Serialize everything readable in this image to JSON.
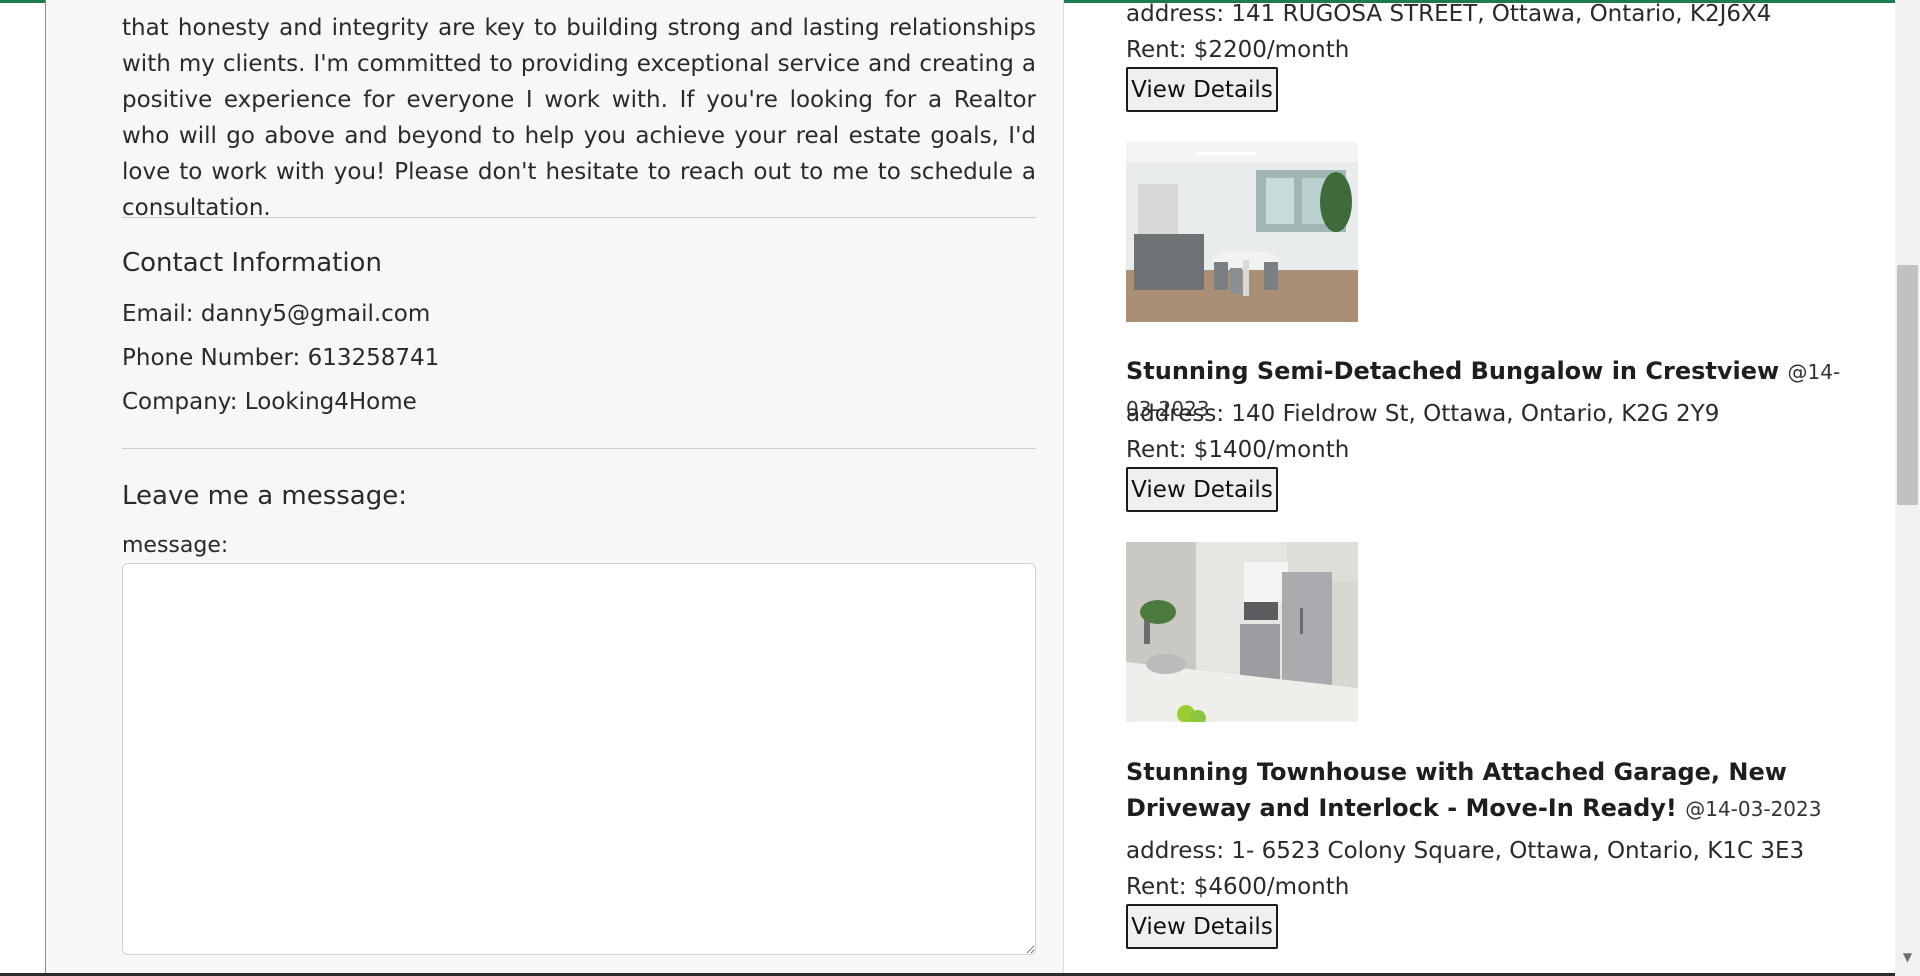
{
  "about": {
    "paragraph": "that honesty and integrity are key to building strong and lasting relationships with my clients. I'm committed to providing exceptional service and creating a positive experience for everyone I work with. If you're looking for a Realtor who will go above and beyond to help you achieve your real estate goals, I'd love to work with you! Please don't hesitate to reach out to me to schedule a consultation."
  },
  "contact": {
    "heading": "Contact Information",
    "email": "Email: danny5@gmail.com",
    "phone": "Phone Number: 613258741",
    "company": "Company: Looking4Home"
  },
  "message_form": {
    "heading": "Leave me a message:",
    "label": "message:",
    "value": ""
  },
  "listings": [
    {
      "address": "address: 141 RUGOSA STREET, Ottawa, Ontario, K2J6X4",
      "rent": "Rent: $2200/month",
      "button": "View Details"
    },
    {
      "title": "Stunning Semi-Detached Bungalow in Crestview",
      "date": "@14-03-2023",
      "address": "address: 140 Fieldrow St, Ottawa, Ontario, K2G 2Y9",
      "rent": "Rent: $1400/month",
      "button": "View Details"
    },
    {
      "title": "Stunning Townhouse with Attached Garage, New Driveway and Interlock - Move-In Ready!",
      "date": "@14-03-2023",
      "address": "address: 1- 6523 Colony Square, Ottawa, Ontario, K1C 3E3",
      "rent": "Rent: $4600/month",
      "button": "View Details"
    }
  ],
  "colors": {
    "accent": "#1f7a4d",
    "panel_bg": "#f7f7f7"
  }
}
